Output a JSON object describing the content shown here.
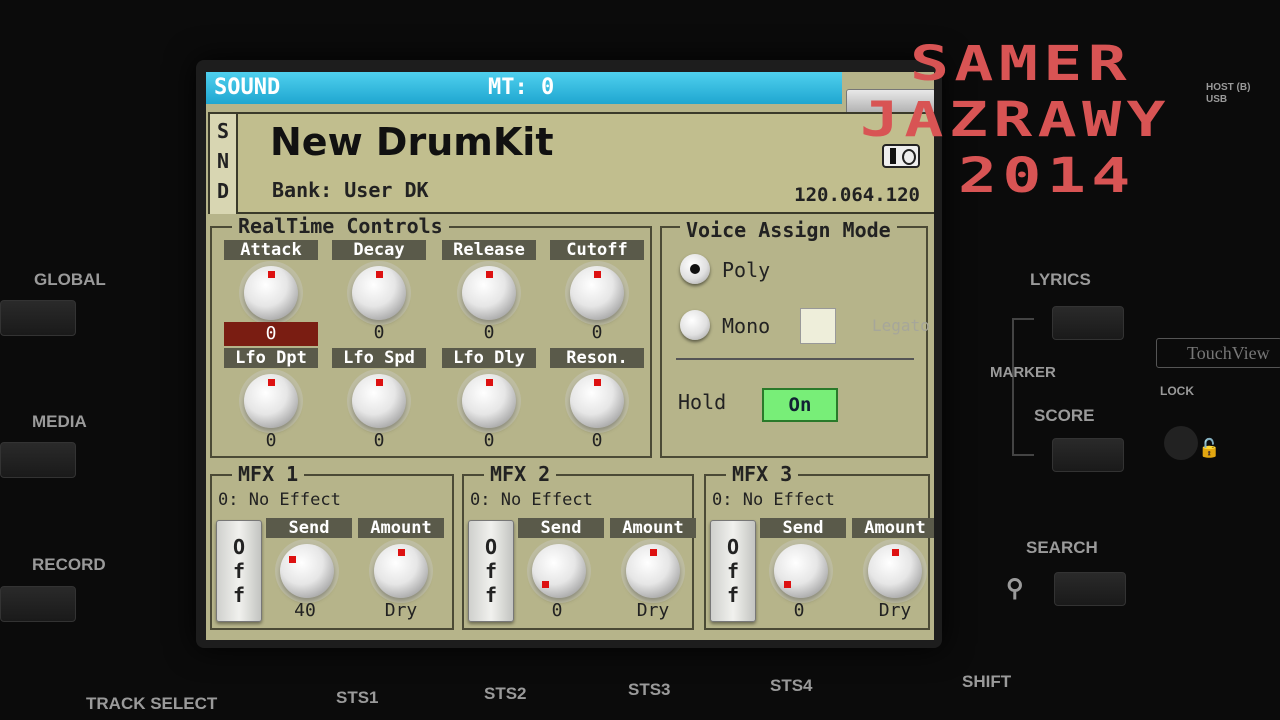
{
  "watermark": {
    "line1": "SAMER",
    "line2": "JAZRAWY",
    "line3": "2014"
  },
  "panel": {
    "left_labels": [
      "GLOBAL",
      "MEDIA",
      "RECORD"
    ],
    "right_labels": {
      "lyrics": "LYRICS",
      "marker": "MARKER",
      "score": "SCORE",
      "search": "SEARCH",
      "lock": "LOCK",
      "touchview": "TouchView",
      "host": "HOST (B) USB"
    },
    "bottom_labels": [
      "TRACK SELECT",
      "STS1",
      "STS2",
      "STS3",
      "STS4",
      "SHIFT"
    ]
  },
  "screen": {
    "title": "SOUND",
    "mt": "MT: 0",
    "snd_letters": [
      "S",
      "N",
      "D"
    ],
    "kit_name": "New DrumKit",
    "bank": "Bank: User DK",
    "program_number": "120.064.120",
    "realtime": {
      "title": "RealTime Controls",
      "knobs": [
        {
          "label": "Attack",
          "value": "0",
          "level": 0.5,
          "selected": true
        },
        {
          "label": "Decay",
          "value": "0",
          "level": 0.5
        },
        {
          "label": "Release",
          "value": "0",
          "level": 0.5
        },
        {
          "label": "Cutoff",
          "value": "0",
          "level": 0.5
        },
        {
          "label": "Lfo Dpt",
          "value": "0",
          "level": 0.5
        },
        {
          "label": "Lfo Spd",
          "value": "0",
          "level": 0.5
        },
        {
          "label": "Lfo Dly",
          "value": "0",
          "level": 0.5
        },
        {
          "label": "Reson.",
          "value": "0",
          "level": 0.5
        }
      ]
    },
    "voice_assign": {
      "title": "Voice Assign Mode",
      "poly": "Poly",
      "mono": "Mono",
      "legato": "Legato",
      "selected": "Poly",
      "hold_label": "Hold",
      "hold_value": "On"
    },
    "mfx": [
      {
        "title": "MFX 1",
        "effect": "0: No Effect",
        "off": [
          "O",
          "f",
          "f"
        ],
        "send_label": "Send",
        "send_value": "40",
        "amount_label": "Amount",
        "amount_value": "Dry",
        "send_level": 0.31,
        "amount_level": 0.5
      },
      {
        "title": "MFX 2",
        "effect": "0: No Effect",
        "off": [
          "O",
          "f",
          "f"
        ],
        "send_label": "Send",
        "send_value": "0",
        "amount_label": "Amount",
        "amount_value": "Dry",
        "send_level": 0.0,
        "amount_level": 0.5
      },
      {
        "title": "MFX 3",
        "effect": "0: No Effect",
        "off": [
          "O",
          "f",
          "f"
        ],
        "send_label": "Send",
        "send_value": "0",
        "amount_label": "Amount",
        "amount_value": "Dry",
        "send_level": 0.0,
        "amount_level": 0.5
      }
    ]
  },
  "colors": {
    "lcd_bg": "#b6b48a",
    "title_bar": "#2bb6dd",
    "selected_value": "#7a1d12",
    "hold_on": "#78ee78",
    "knob_marker": "#dd1111",
    "watermark": "#d85454"
  }
}
